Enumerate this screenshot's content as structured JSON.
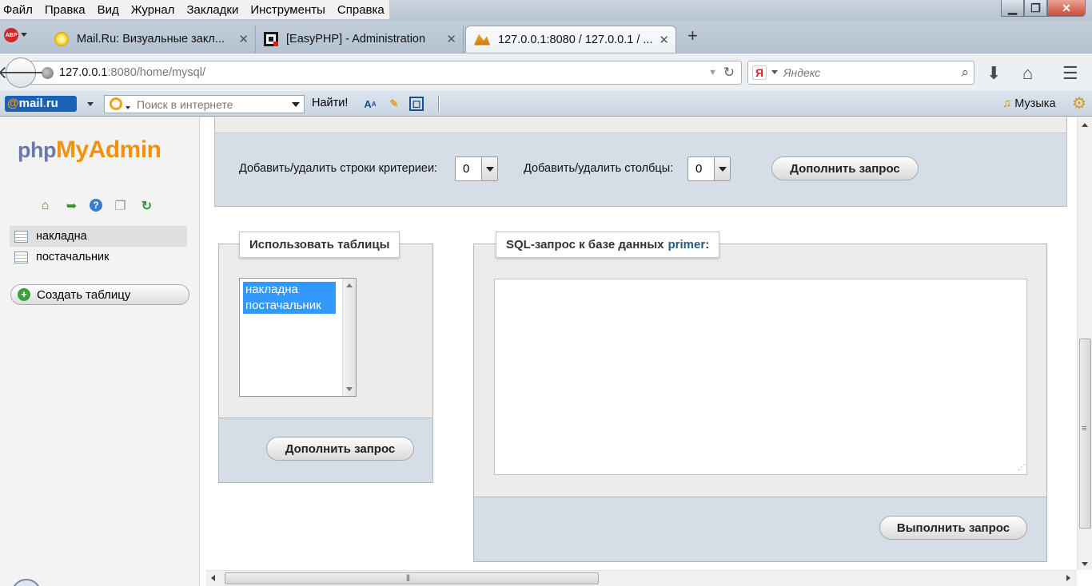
{
  "browser": {
    "menu": [
      "Файл",
      "Правка",
      "Вид",
      "Журнал",
      "Закладки",
      "Инструменты",
      "Справка"
    ],
    "window_controls": {
      "minimize": "▁",
      "maximize": "❐",
      "close": "✕"
    },
    "adblock_label": "ABP",
    "tabs": [
      {
        "label": "Mail.Ru: Визуальные закл...",
        "icon": "mailru-tab-icon",
        "close": "✕"
      },
      {
        "label": "[EasyPHP] - Administration",
        "icon": "easyphp-tab-icon",
        "close": "✕"
      },
      {
        "label": "127.0.0.1:8080 / 127.0.0.1 / ...",
        "icon": "phpmyadmin-tab-icon",
        "close": "✕"
      }
    ],
    "new_tab": "+",
    "url_host": "127.0.0.1",
    "url_path": ":8080/home/mysql/",
    "search_placeholder": "Яндекс",
    "search_engine_badge": "Я"
  },
  "mailru_toolbar": {
    "logo_at": "@",
    "logo_mail": "mail",
    "logo_dot": ".",
    "logo_ru": "ru",
    "search_placeholder": "Поиск в интернете",
    "find_button": "Найти!",
    "music_label": "Музыка"
  },
  "sidebar": {
    "logo_php": "php",
    "logo_myadmin": "MyAdmin",
    "tables": [
      "накладна",
      "постачальник"
    ],
    "create_table": "Создать таблицу"
  },
  "criteria": {
    "rows_label": "Добавить/удалить строки критериеи:",
    "rows_value": "0",
    "cols_label": "Добавить/удалить столбцы:",
    "cols_value": "0",
    "update_button": "Дополнить запрос"
  },
  "use_tables": {
    "legend": "Использовать таблицы",
    "options": [
      "накладна",
      "постачальник"
    ],
    "update_button": "Дополнить запрос"
  },
  "sql_query": {
    "legend_prefix": "SQL-запрос к базе данных",
    "database": "primer",
    "legend_suffix": ":",
    "textarea_value": "",
    "submit_button": "Выполнить запрос"
  }
}
